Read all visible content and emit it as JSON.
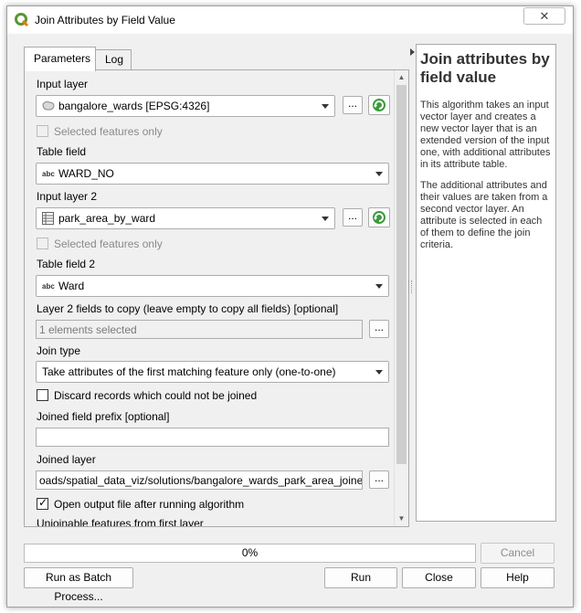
{
  "window": {
    "title": "Join Attributes by Field Value",
    "close_glyph": "✕"
  },
  "tabs": [
    {
      "label": "Parameters",
      "active": true
    },
    {
      "label": "Log",
      "active": false
    }
  ],
  "form": {
    "input_layer": {
      "label": "Input layer",
      "value": "bangalore_wards [EPSG:4326]",
      "icon": "polygon-layer-icon",
      "selected_only_label": "Selected features only",
      "selected_only_checked": false
    },
    "table_field": {
      "label": "Table field",
      "value": "WARD_NO",
      "type_badge": "abc"
    },
    "input_layer_2": {
      "label": "Input layer 2",
      "value": "park_area_by_ward",
      "icon": "table-layer-icon",
      "selected_only_label": "Selected features only",
      "selected_only_checked": false
    },
    "table_field_2": {
      "label": "Table field 2",
      "value": "Ward",
      "type_badge": "abc"
    },
    "layer2_fields": {
      "label": "Layer 2 fields to copy (leave empty to copy all fields) [optional]",
      "value": "1 elements selected"
    },
    "join_type": {
      "label": "Join type",
      "value": "Take attributes of the first matching feature only (one-to-one)"
    },
    "discard": {
      "label": "Discard records which could not be joined",
      "checked": false
    },
    "prefix": {
      "label": "Joined field prefix [optional]",
      "value": ""
    },
    "joined_layer": {
      "label": "Joined layer",
      "value": "oads/spatial_data_viz/solutions/bangalore_wards_park_area_joined.gpkg"
    },
    "open_output": {
      "label": "Open output file after running algorithm",
      "checked": true
    },
    "unjoinable_label": "Unjoinable features from first layer",
    "browse_label": "...",
    "check_glyph": "✓"
  },
  "help": {
    "title": "Join attributes by field value",
    "paragraphs": [
      "This algorithm takes an input vector layer and creates a new vector layer that is an extended version of the input one, with additional attributes in its attribute table.",
      "The additional attributes and their values are taken from a second vector layer. An attribute is selected in each of them to define the join criteria."
    ]
  },
  "progress": {
    "value": 0,
    "text": "0%"
  },
  "buttons": {
    "cancel": "Cancel",
    "batch": "Run as Batch Process...",
    "run": "Run",
    "close": "Close",
    "help": "Help"
  },
  "colors": {
    "iterate_green": "#3c9a3c"
  }
}
